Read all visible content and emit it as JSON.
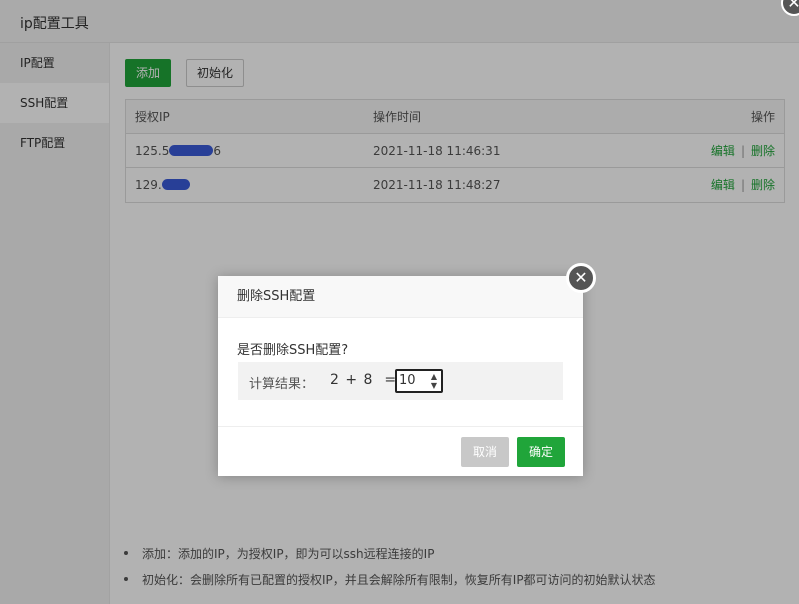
{
  "window": {
    "title": "ip配置工具",
    "close_glyph": "✕"
  },
  "sidebar": {
    "items": [
      {
        "label": "IP配置",
        "active": false
      },
      {
        "label": "SSH配置",
        "active": true
      },
      {
        "label": "FTP配置",
        "active": false
      }
    ]
  },
  "toolbar": {
    "add_label": "添加",
    "init_label": "初始化"
  },
  "table": {
    "columns": [
      "授权IP",
      "操作时间",
      "操作"
    ],
    "rows": [
      {
        "ip_prefix": "125.5",
        "ip_suffix": "6",
        "time": "2021-11-18 11:46:31",
        "edit": "编辑",
        "delete": "删除"
      },
      {
        "ip_prefix": "129.",
        "ip_suffix": "",
        "time": "2021-11-18 11:48:27",
        "edit": "编辑",
        "delete": "删除"
      }
    ],
    "separator": "|"
  },
  "notes": [
    "添加：添加的IP，为授权IP，即为可以ssh远程连接的IP",
    "初始化：会删除所有已配置的授权IP，并且会解除所有限制，恢复所有IP都可访问的初始默认状态"
  ],
  "dialog": {
    "title": "删除SSH配置",
    "question": "是否删除SSH配置?",
    "calc_label": "计算结果：",
    "calc_expression": "2 + 8  =",
    "calc_value": "10",
    "cancel_label": "取消",
    "ok_label": "确定",
    "close_glyph": "✕"
  },
  "colors": {
    "accent": "#20a53a",
    "redaction": "#3a5bd9"
  },
  "icons": {
    "window_close": "close-icon",
    "dialog_close": "close-icon",
    "spinner": "spinner-arrows-icon"
  }
}
